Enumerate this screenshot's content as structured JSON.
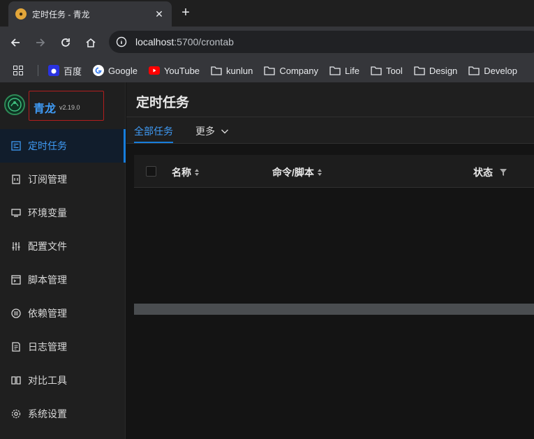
{
  "browser": {
    "tab_title": "定时任务 - 青龙",
    "url_host": "localhost",
    "url_path": ":5700/crontab",
    "bookmarks": [
      {
        "label": "百度",
        "icon": "baidu-icon"
      },
      {
        "label": "Google",
        "icon": "google-icon"
      },
      {
        "label": "YouTube",
        "icon": "youtube-icon"
      },
      {
        "label": "kunlun",
        "icon": "folder-icon"
      },
      {
        "label": "Company",
        "icon": "folder-icon"
      },
      {
        "label": "Life",
        "icon": "folder-icon"
      },
      {
        "label": "Tool",
        "icon": "folder-icon"
      },
      {
        "label": "Design",
        "icon": "folder-icon"
      },
      {
        "label": "Develop",
        "icon": "folder-icon"
      }
    ]
  },
  "app": {
    "name": "青龙",
    "version": "v2.19.0",
    "accent": "#3f9bf6"
  },
  "sidebar": {
    "items": [
      {
        "label": "定时任务",
        "icon": "crontab-icon",
        "active": true
      },
      {
        "label": "订阅管理",
        "icon": "subscription-icon"
      },
      {
        "label": "环境变量",
        "icon": "env-icon"
      },
      {
        "label": "配置文件",
        "icon": "config-icon"
      },
      {
        "label": "脚本管理",
        "icon": "script-icon"
      },
      {
        "label": "依赖管理",
        "icon": "dependence-icon"
      },
      {
        "label": "日志管理",
        "icon": "log-icon"
      },
      {
        "label": "对比工具",
        "icon": "diff-icon"
      },
      {
        "label": "系统设置",
        "icon": "settings-icon"
      }
    ]
  },
  "page": {
    "title": "定时任务",
    "tabs": {
      "all": "全部任务",
      "more": "更多"
    },
    "columns": {
      "name": "名称",
      "command": "命令/脚本",
      "status": "状态"
    }
  }
}
